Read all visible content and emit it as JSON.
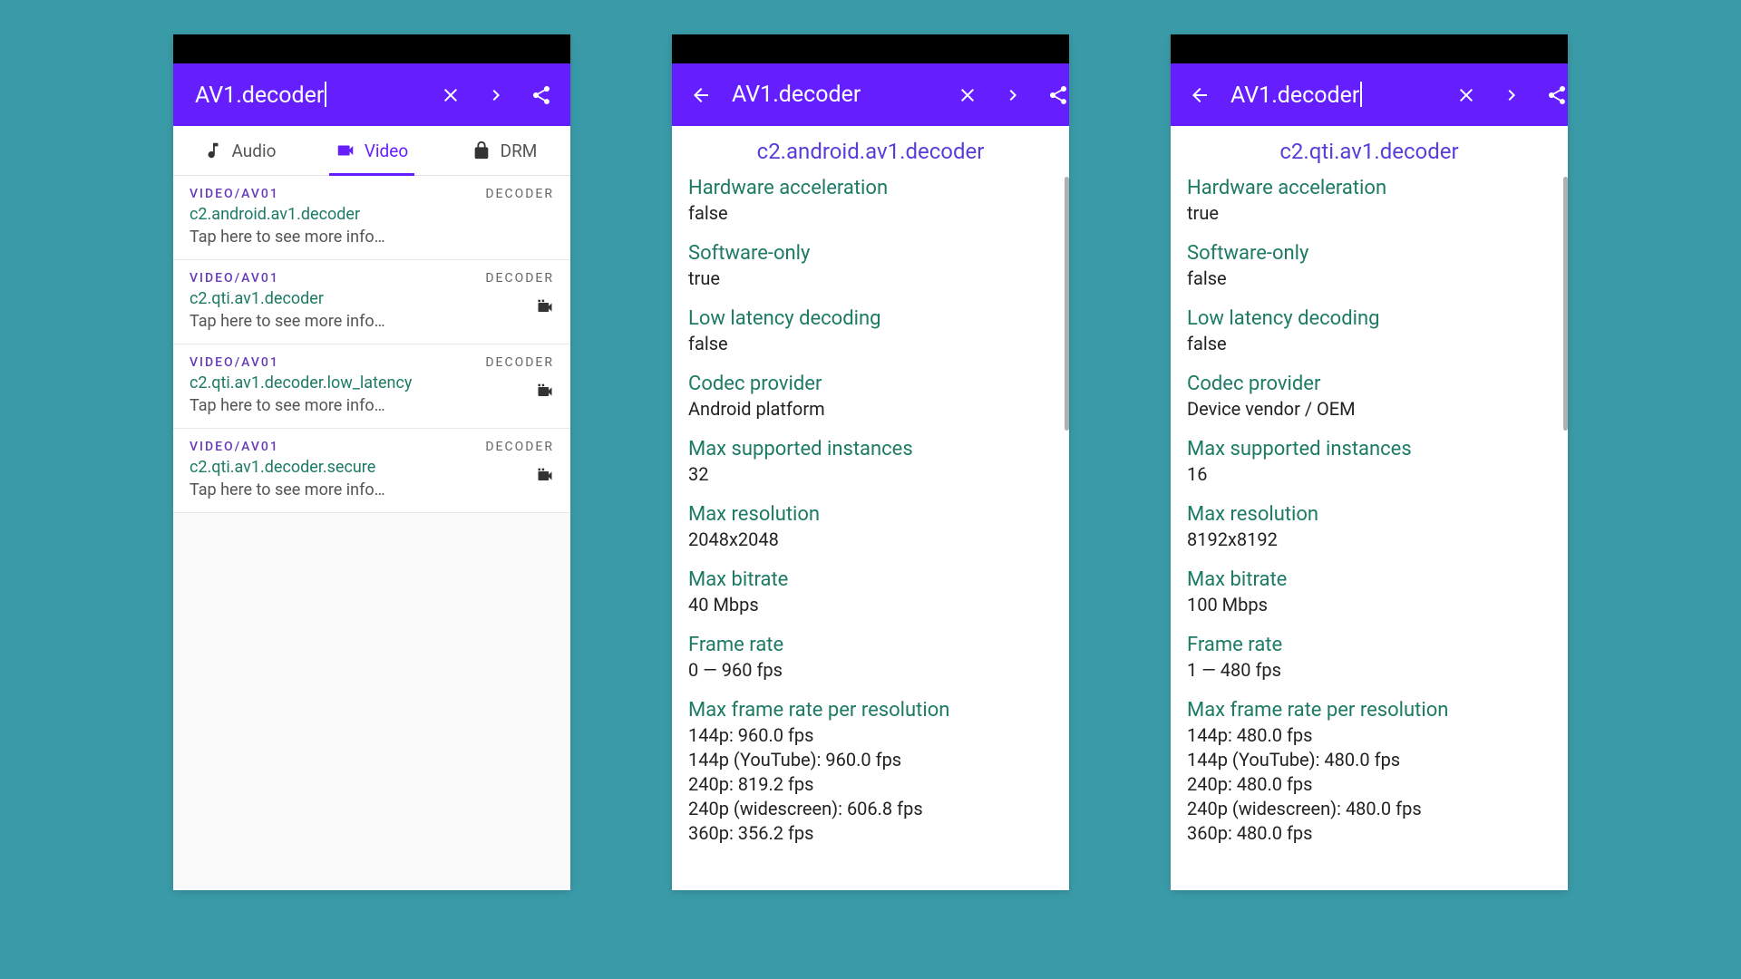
{
  "search_query": "AV1.decoder",
  "tabs": {
    "audio": "Audio",
    "video": "Video",
    "drm": "DRM"
  },
  "screen1": {
    "items": [
      {
        "mime": "VIDEO/AV01",
        "name": "c2.android.av1.decoder",
        "hint": "Tap here to see more info…",
        "badge": "DECODER",
        "hw": false
      },
      {
        "mime": "VIDEO/AV01",
        "name": "c2.qti.av1.decoder",
        "hint": "Tap here to see more info…",
        "badge": "DECODER",
        "hw": true
      },
      {
        "mime": "VIDEO/AV01",
        "name": "c2.qti.av1.decoder.low_latency",
        "hint": "Tap here to see more info…",
        "badge": "DECODER",
        "hw": true
      },
      {
        "mime": "VIDEO/AV01",
        "name": "c2.qti.av1.decoder.secure",
        "hint": "Tap here to see more info…",
        "badge": "DECODER",
        "hw": true
      }
    ]
  },
  "screen2": {
    "title": "c2.android.av1.decoder",
    "props": [
      {
        "k": "Hardware acceleration",
        "v": "false"
      },
      {
        "k": "Software-only",
        "v": "true"
      },
      {
        "k": "Low latency decoding",
        "v": "false"
      },
      {
        "k": "Codec provider",
        "v": "Android platform"
      },
      {
        "k": "Max supported instances",
        "v": "32"
      },
      {
        "k": "Max resolution",
        "v": "2048x2048"
      },
      {
        "k": "Max bitrate",
        "v": "40 Mbps"
      },
      {
        "k": "Frame rate",
        "v": "0 — 960 fps"
      },
      {
        "k": "Max frame rate per resolution",
        "v": "144p: 960.0 fps\n144p (YouTube): 960.0 fps\n240p: 819.2 fps\n240p (widescreen): 606.8 fps\n360p: 356.2 fps"
      }
    ]
  },
  "screen3": {
    "title": "c2.qti.av1.decoder",
    "props": [
      {
        "k": "Hardware acceleration",
        "v": "true"
      },
      {
        "k": "Software-only",
        "v": "false"
      },
      {
        "k": "Low latency decoding",
        "v": "false"
      },
      {
        "k": "Codec provider",
        "v": "Device vendor / OEM"
      },
      {
        "k": "Max supported instances",
        "v": "16"
      },
      {
        "k": "Max resolution",
        "v": "8192x8192"
      },
      {
        "k": "Max bitrate",
        "v": "100 Mbps"
      },
      {
        "k": "Frame rate",
        "v": "1 — 480 fps"
      },
      {
        "k": "Max frame rate per resolution",
        "v": "144p: 480.0 fps\n144p (YouTube): 480.0 fps\n240p: 480.0 fps\n240p (widescreen): 480.0 fps\n360p: 480.0 fps"
      }
    ]
  }
}
